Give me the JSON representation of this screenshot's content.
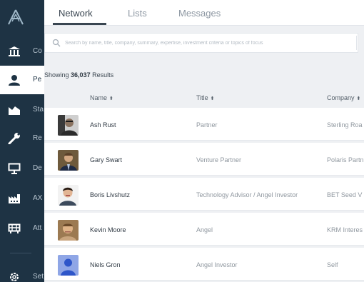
{
  "nav": {
    "items": [
      {
        "label": "Co",
        "icon": "bank-icon"
      },
      {
        "label": "Pe",
        "icon": "person-icon",
        "active": true
      },
      {
        "label": "Sta",
        "icon": "chart-icon"
      },
      {
        "label": "Re",
        "icon": "wrench-icon"
      },
      {
        "label": "De",
        "icon": "presentation-icon"
      },
      {
        "label": "AX",
        "icon": "factory-icon"
      },
      {
        "label": "Att",
        "icon": "grid-icon"
      },
      {
        "label": "Set",
        "icon": "gear-icon"
      }
    ]
  },
  "tabs": {
    "network": "Network",
    "lists": "Lists",
    "messages": "Messages",
    "active": "Network"
  },
  "search": {
    "placeholder": "Search by name, title, company, summary, expertise, investment criteria or topics of focus"
  },
  "summary": {
    "prefix": "Showing",
    "count": "36,037",
    "suffix": "Results"
  },
  "table": {
    "headers": {
      "name": "Name",
      "title": "Title",
      "company": "Company"
    },
    "sort_icon": "⬍",
    "rows": [
      {
        "name": "Ash Rust",
        "title": "Partner",
        "company": "Sterling Roa"
      },
      {
        "name": "Gary Swart",
        "title": "Venture Partner",
        "company": "Polaris Partn"
      },
      {
        "name": "Boris Livshutz",
        "title": "Technology Advisor / Angel Investor",
        "company": "BET Seed V"
      },
      {
        "name": "Kevin Moore",
        "title": "Angel",
        "company": "KRM Interes"
      },
      {
        "name": "Niels Gron",
        "title": "Angel Investor",
        "company": "Self"
      }
    ]
  },
  "colors": {
    "sidebar": "#1e3344",
    "placeholder_avatar": "#8fa6e6"
  }
}
